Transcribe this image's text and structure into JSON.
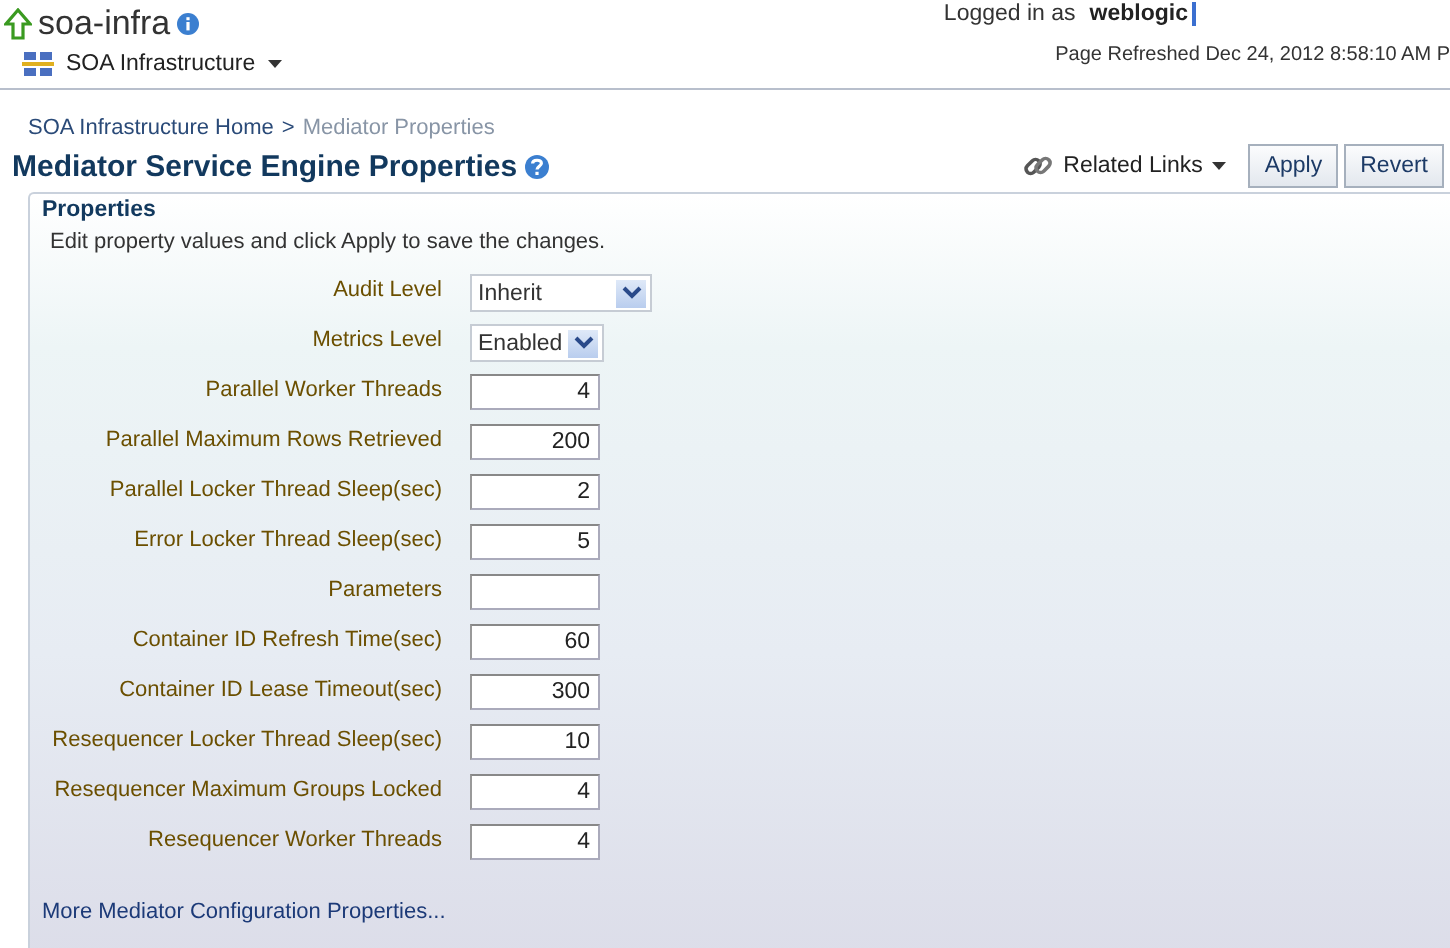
{
  "header": {
    "title": "soa-infra",
    "menu": "SOA Infrastructure",
    "logged_in_label": "Logged in as",
    "user": "weblogic",
    "refreshed": "Page Refreshed Dec 24, 2012 8:58:10 AM P"
  },
  "breadcrumb": [
    {
      "label": "SOA Infrastructure Home",
      "current": false
    },
    {
      "label": "Mediator Properties",
      "current": true
    }
  ],
  "breadcrumb_separator": ">",
  "page_title": "Mediator Service Engine Properties",
  "toolbar": {
    "related_links": "Related Links",
    "buttons": [
      "Apply",
      "Revert"
    ]
  },
  "section": {
    "title": "Properties",
    "instructions": "Edit property values and click Apply to save the changes."
  },
  "fields": [
    {
      "label": "Audit Level",
      "kind": "select",
      "value": "Inherit"
    },
    {
      "label": "Metrics Level",
      "kind": "select",
      "value": "Enabled"
    },
    {
      "label": "Parallel Worker Threads",
      "kind": "text",
      "value": "4"
    },
    {
      "label": "Parallel Maximum Rows Retrieved",
      "kind": "text",
      "value": "200"
    },
    {
      "label": "Parallel Locker Thread Sleep(sec)",
      "kind": "text",
      "value": "2"
    },
    {
      "label": "Error Locker Thread Sleep(sec)",
      "kind": "text",
      "value": "5"
    },
    {
      "label": "Parameters",
      "kind": "text"
    },
    {
      "label": "Container ID Refresh Time(sec)",
      "kind": "text",
      "value": "60"
    },
    {
      "label": "Container ID Lease Timeout(sec)",
      "kind": "text",
      "value": "300"
    },
    {
      "label": "Resequencer Locker Thread Sleep(sec)",
      "kind": "text",
      "value": "10"
    },
    {
      "label": "Resequencer Maximum Groups Locked",
      "kind": "text",
      "value": "4"
    },
    {
      "label": "Resequencer Worker Threads",
      "kind": "text",
      "value": "4"
    }
  ],
  "footer_link": "More Mediator Configuration Properties..."
}
